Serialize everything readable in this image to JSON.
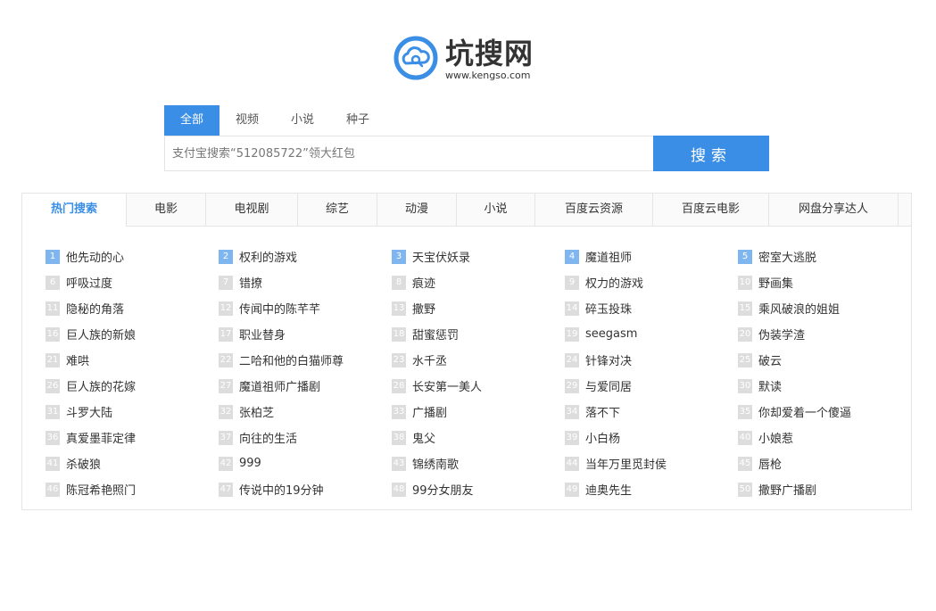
{
  "logo": {
    "title": "坑搜网",
    "subtitle": "www.kengso.com",
    "icon": "cloud-search-icon",
    "accent": "#3a8ee6"
  },
  "search": {
    "tabs": [
      "全部",
      "视频",
      "小说",
      "种子"
    ],
    "active_tab": "全部",
    "placeholder": "支付宝搜索“512085722”领大红包",
    "button_label": "搜索"
  },
  "categories": [
    "热门搜索",
    "电影",
    "电视剧",
    "综艺",
    "动漫",
    "小说",
    "百度云资源",
    "百度云电影",
    "网盘分享达人"
  ],
  "active_category": "热门搜索",
  "hot_items": [
    {
      "rank": "1",
      "text": "他先动的心"
    },
    {
      "rank": "2",
      "text": "权利的游戏"
    },
    {
      "rank": "3",
      "text": "天宝伏妖录"
    },
    {
      "rank": "4",
      "text": "魔道祖师"
    },
    {
      "rank": "5",
      "text": "密室大逃脱"
    },
    {
      "rank": "6",
      "text": "呼吸过度"
    },
    {
      "rank": "7",
      "text": "错撩"
    },
    {
      "rank": "8",
      "text": "痕迹"
    },
    {
      "rank": "9",
      "text": "权力的游戏"
    },
    {
      "rank": "10",
      "text": "野画集"
    },
    {
      "rank": "11",
      "text": "隐秘的角落"
    },
    {
      "rank": "12",
      "text": "传闻中的陈芊芊"
    },
    {
      "rank": "13",
      "text": "撒野"
    },
    {
      "rank": "14",
      "text": "碎玉投珠"
    },
    {
      "rank": "15",
      "text": "乘风破浪的姐姐"
    },
    {
      "rank": "16",
      "text": "巨人族的新娘"
    },
    {
      "rank": "17",
      "text": "职业替身"
    },
    {
      "rank": "18",
      "text": "甜蜜惩罚"
    },
    {
      "rank": "19",
      "text": "seegasm"
    },
    {
      "rank": "20",
      "text": "伪装学渣"
    },
    {
      "rank": "21",
      "text": "难哄"
    },
    {
      "rank": "22",
      "text": "二哈和他的白猫师尊"
    },
    {
      "rank": "23",
      "text": "水千丞"
    },
    {
      "rank": "24",
      "text": "针锋对决"
    },
    {
      "rank": "25",
      "text": "破云"
    },
    {
      "rank": "26",
      "text": "巨人族的花嫁"
    },
    {
      "rank": "27",
      "text": "魔道祖师广播剧"
    },
    {
      "rank": "28",
      "text": "长安第一美人"
    },
    {
      "rank": "29",
      "text": "与爱同居"
    },
    {
      "rank": "30",
      "text": "默读"
    },
    {
      "rank": "31",
      "text": "斗罗大陆"
    },
    {
      "rank": "32",
      "text": "张柏芝"
    },
    {
      "rank": "33",
      "text": "广播剧"
    },
    {
      "rank": "34",
      "text": "落不下"
    },
    {
      "rank": "35",
      "text": "你却爱着一个傻逼"
    },
    {
      "rank": "36",
      "text": "真爱墨菲定律"
    },
    {
      "rank": "37",
      "text": "向往的生活"
    },
    {
      "rank": "38",
      "text": "鬼父"
    },
    {
      "rank": "39",
      "text": "小白杨"
    },
    {
      "rank": "40",
      "text": "小娘惹"
    },
    {
      "rank": "41",
      "text": "杀破狼"
    },
    {
      "rank": "42",
      "text": "999"
    },
    {
      "rank": "43",
      "text": "锦绣南歌"
    },
    {
      "rank": "44",
      "text": "当年万里觅封侯"
    },
    {
      "rank": "45",
      "text": "唇枪"
    },
    {
      "rank": "46",
      "text": "陈冠希艳照门"
    },
    {
      "rank": "47",
      "text": "传说中的19分钟"
    },
    {
      "rank": "48",
      "text": "99分女朋友"
    },
    {
      "rank": "49",
      "text": "迪奥先生"
    },
    {
      "rank": "50",
      "text": "撒野广播剧"
    }
  ]
}
